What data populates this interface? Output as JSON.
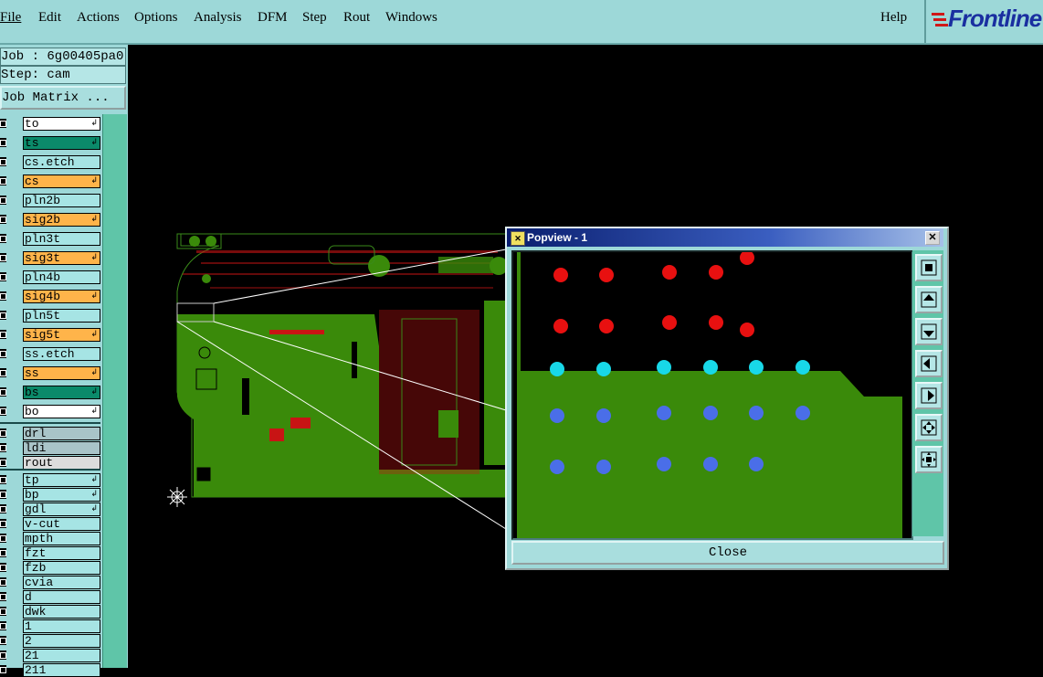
{
  "menubar": {
    "items": [
      "File",
      "Edit",
      "Actions",
      "Options",
      "Analysis",
      "DFM",
      "Step",
      "Rout",
      "Windows"
    ],
    "help": "Help",
    "logo_text": "Frontline"
  },
  "leftpanel": {
    "job_label": "Job : 6g00405pa0",
    "step_label": "Step: cam",
    "job_matrix": "Job Matrix ...",
    "layers": [
      {
        "name": "to",
        "color": "#ffffff",
        "arrow": true
      },
      {
        "name": "ts",
        "color": "#0b8a6a",
        "arrow": true
      },
      {
        "name": "cs.etch",
        "color": "#a6e4e4",
        "arrow": false
      },
      {
        "name": "cs",
        "color": "#ffb44a",
        "arrow": true
      },
      {
        "name": "pln2b",
        "color": "#a6e4e4",
        "arrow": false
      },
      {
        "name": "sig2b",
        "color": "#ffb44a",
        "arrow": true
      },
      {
        "name": "pln3t",
        "color": "#a6e4e4",
        "arrow": false
      },
      {
        "name": "sig3t",
        "color": "#ffb44a",
        "arrow": true
      },
      {
        "name": "pln4b",
        "color": "#a6e4e4",
        "arrow": false
      },
      {
        "name": "sig4b",
        "color": "#ffb44a",
        "arrow": true
      },
      {
        "name": "pln5t",
        "color": "#a6e4e4",
        "arrow": false
      },
      {
        "name": "sig5t",
        "color": "#ffb44a",
        "arrow": true
      },
      {
        "name": "ss.etch",
        "color": "#a6e4e4",
        "arrow": false
      },
      {
        "name": "ss",
        "color": "#ffb44a",
        "arrow": true
      },
      {
        "name": "bs",
        "color": "#0b8a6a",
        "arrow": true
      },
      {
        "name": "bo",
        "color": "#ffffff",
        "arrow": true
      },
      {
        "name": "drl",
        "color": "#a9c4c8",
        "arrow": false
      },
      {
        "name": "ldi",
        "color": "#a9c4c8",
        "arrow": false
      },
      {
        "name": "rout",
        "color": "#dcdcdc",
        "arrow": false
      },
      {
        "name": "tp",
        "color": "#a6e4e4",
        "arrow": true
      },
      {
        "name": "bp",
        "color": "#a6e4e4",
        "arrow": true
      },
      {
        "name": "gdl",
        "color": "#a6e4e4",
        "arrow": true
      },
      {
        "name": "v-cut",
        "color": "#a6e4e4",
        "arrow": false
      },
      {
        "name": "mpth",
        "color": "#a6e4e4",
        "arrow": false
      },
      {
        "name": "fzt",
        "color": "#a6e4e4",
        "arrow": false
      },
      {
        "name": "fzb",
        "color": "#a6e4e4",
        "arrow": false
      },
      {
        "name": "cvia",
        "color": "#a6e4e4",
        "arrow": false
      },
      {
        "name": "d",
        "color": "#a6e4e4",
        "arrow": false
      },
      {
        "name": "dwk",
        "color": "#a6e4e4",
        "arrow": false
      },
      {
        "name": "1",
        "color": "#a6e4e4",
        "arrow": false
      },
      {
        "name": "2",
        "color": "#a6e4e4",
        "arrow": false
      },
      {
        "name": "21",
        "color": "#a6e4e4",
        "arrow": false
      },
      {
        "name": "211",
        "color": "#a6e4e4",
        "arrow": false
      }
    ]
  },
  "popview": {
    "title": "Popview - 1",
    "close_label": "Close"
  }
}
